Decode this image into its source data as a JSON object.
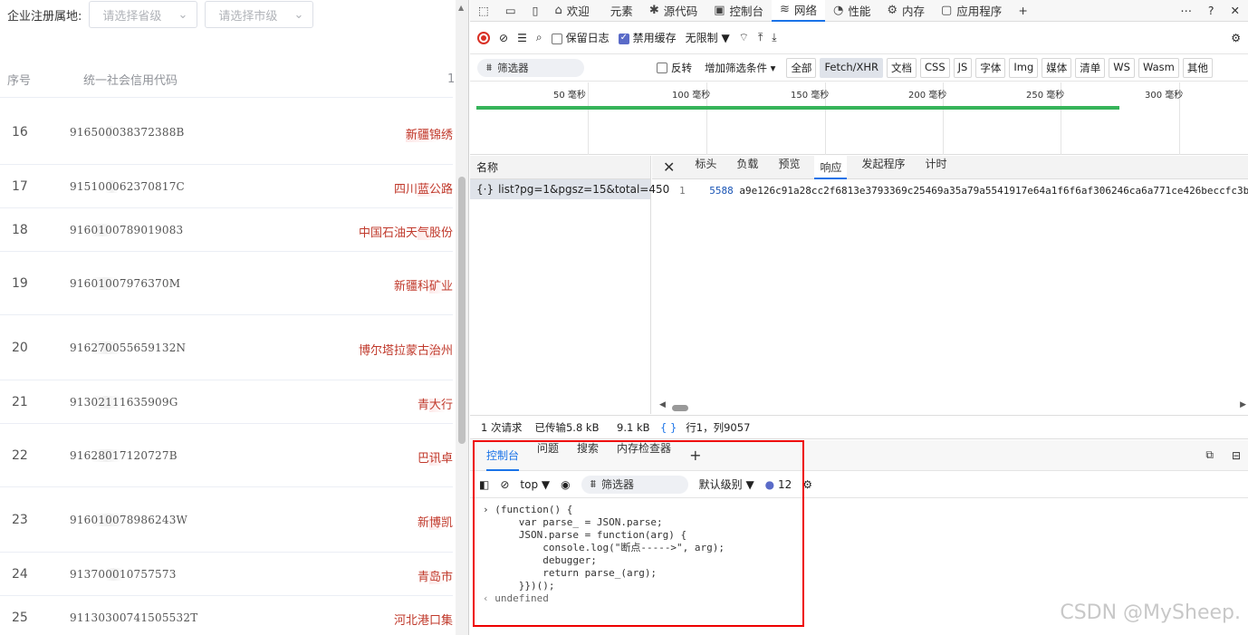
{
  "left_page": {
    "filter_label": "企业注册属地:",
    "province_placeholder": "请选择省级",
    "city_placeholder": "请选择市级",
    "table_headers": {
      "index": "序号",
      "code": "统一社会信用代码",
      "more": "1"
    },
    "rows": [
      {
        "idx": "16",
        "code_a": "91650",
        "code_b": "00",
        "code_c": "38372388B",
        "name_a": "",
        "name_b": "新疆锦绣",
        "name_c": ""
      },
      {
        "idx": "17",
        "code_a": "91510",
        "code_b": "006",
        "code_c": "2370817C",
        "name_a": "四川",
        "name_b": "蓝公路",
        "name_c": ""
      },
      {
        "idx": "18",
        "code_a": "916",
        "code_b": "01007",
        "code_c": "89019083",
        "name_a": "中国石油天",
        "name_b": "气股份",
        "name_c": ""
      },
      {
        "idx": "19",
        "code_a": "916",
        "code_b": "010079",
        "code_c": "76370M",
        "name_a": "新疆科",
        "name_b": "矿业",
        "name_c": ""
      },
      {
        "idx": "20",
        "code_a": "916",
        "code_b": "2700556",
        "code_c": "59132N",
        "name_a": "博尔塔拉蒙古",
        "name_b": "治州",
        "name_c": ""
      },
      {
        "idx": "21",
        "code_a": "913",
        "code_b": "0211163",
        "code_c": "5909G",
        "name_a": "青",
        "name_b": "大行",
        "name_c": ""
      },
      {
        "idx": "22",
        "code_a": "916",
        "code_b": "2801712",
        "code_c": "0727B",
        "name_a": "巴",
        "name_b": "讯卓",
        "name_c": ""
      },
      {
        "idx": "23",
        "code_a": "916",
        "code_b": "01007898",
        "code_c": "6243W",
        "name_a": "新",
        "name_b": "博凯",
        "name_c": ""
      },
      {
        "idx": "24",
        "code_a": "91370",
        "code_b": "0010",
        "code_c": "757573",
        "name_a": "青",
        "name_b": "岛市",
        "name_c": ""
      },
      {
        "idx": "25",
        "code_a": "91130300741505532T",
        "code_b": "",
        "code_c": "",
        "name_a": "河北港口集",
        "name_b": "",
        "name_c": ""
      }
    ]
  },
  "devtools": {
    "main_tabs": [
      {
        "label": "欢迎",
        "icon": "home-icon"
      },
      {
        "label": "元素",
        "icon": "code-icon"
      },
      {
        "label": "源代码",
        "icon": "bug-icon"
      },
      {
        "label": "控制台",
        "icon": "console-icon"
      },
      {
        "label": "网络",
        "icon": "wifi-icon"
      },
      {
        "label": "性能",
        "icon": "gauge-icon"
      },
      {
        "label": "内存",
        "icon": "chip-icon"
      },
      {
        "label": "应用程序",
        "icon": "app-icon"
      }
    ],
    "active_main_tab": "网络",
    "network_toolbar": {
      "preserve_log": "保留日志",
      "disable_cache": "禁用缓存",
      "throttle": "无限制"
    },
    "filter_bar": {
      "filter_placeholder": "筛选器",
      "invert": "反转",
      "more_filters": "增加筛选条件",
      "types": [
        "全部",
        "Fetch/XHR",
        "文档",
        "CSS",
        "JS",
        "字体",
        "Img",
        "媒体",
        "清单",
        "WS",
        "Wasm",
        "其他"
      ],
      "selected_type": "Fetch/XHR"
    },
    "timeline_ticks": [
      "50 毫秒",
      "100 毫秒",
      "150 毫秒",
      "200 毫秒",
      "250 毫秒",
      "300 毫秒"
    ],
    "request_list": {
      "header": "名称",
      "rows": [
        "list?pg=1&pgsz=15&total=450"
      ]
    },
    "detail_tabs": [
      "标头",
      "负载",
      "预览",
      "响应",
      "发起程序",
      "计时"
    ],
    "active_detail_tab": "响应",
    "response": {
      "line_number": "1",
      "first_token": "5588",
      "content": "a9e126c91a28cc2f6813e3793369c25469a35a79a5541917e64a1f6f6af306246ca6a771ce426beccfc3b6"
    },
    "status_bar": {
      "requests": "1 次请求",
      "transferred": "已传输5.8 kB",
      "resources": "9.1 kB",
      "position": "行1，列9057"
    },
    "drawer": {
      "tabs": [
        "控制台",
        "问题",
        "搜索",
        "内存检查器"
      ],
      "active_tab": "控制台",
      "context": "top",
      "filter_placeholder": "筛选器",
      "level": "默认级别",
      "issue_count": "12",
      "code_lines": [
        "(function() {",
        "    var parse_ = JSON.parse;",
        "    JSON.parse = function(arg) {",
        "        console.log(\"断点----->\", arg);",
        "        debugger;",
        "        return parse_(arg);",
        "    }})();"
      ],
      "result": "undefined"
    }
  },
  "watermark": "CSDN @MySheep."
}
